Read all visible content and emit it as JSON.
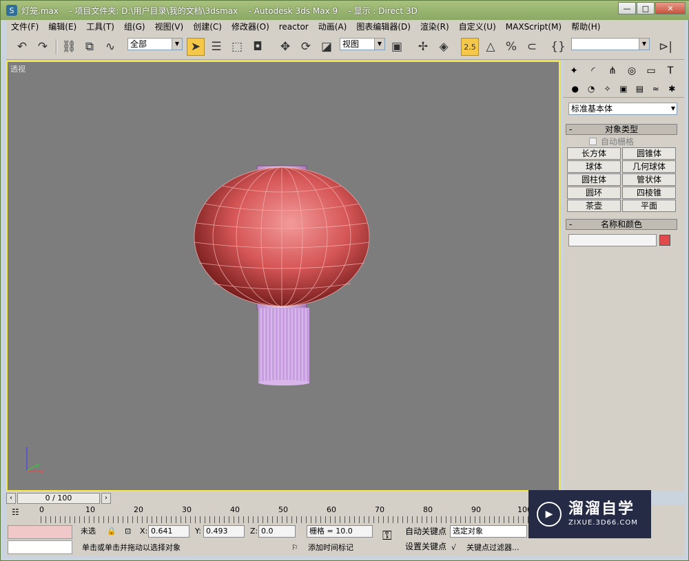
{
  "window": {
    "title": "灯笼.max    - 项目文件夹: D:\\用户目录\\我的文档\\3dsmax    - Autodesk 3ds Max 9    - 显示 : Direct 3D",
    "app_icon": "3ds-max-icon",
    "minimize": "—",
    "maximize": "□",
    "close": "✕"
  },
  "menu": [
    "文件(F)",
    "编辑(E)",
    "工具(T)",
    "组(G)",
    "视图(V)",
    "创建(C)",
    "修改器(O)",
    "reactor",
    "动画(A)",
    "图表编辑器(D)",
    "渲染(R)",
    "自定义(U)",
    "MAXScript(M)",
    "帮助(H)"
  ],
  "toolbar": {
    "selection_filter": "全部",
    "reference_coord": "视图",
    "snap_value": "2.5",
    "named_selection": ""
  },
  "viewport": {
    "label": "透视",
    "object": "lantern"
  },
  "command_panel": {
    "category": "标准基本体",
    "object_type_title": "对象类型",
    "auto_grid": "自动栅格",
    "object_buttons": [
      "长方体",
      "圆锥体",
      "球体",
      "几何球体",
      "圆柱体",
      "管状体",
      "圆环",
      "四棱锥",
      "茶壶",
      "平面"
    ],
    "name_color_title": "名称和颜色",
    "name_value": "",
    "swatch_color": "#e04a4a"
  },
  "timeline": {
    "frame_display": "0 / 100",
    "ticks": [
      "0",
      "10",
      "20",
      "30",
      "40",
      "50",
      "60",
      "70",
      "80",
      "90",
      "100"
    ]
  },
  "status": {
    "selection_status": "未选",
    "x_label": "X:",
    "x_value": "0.641",
    "y_label": "Y:",
    "y_value": "0.493",
    "z_label": "Z:",
    "z_value": "0.0",
    "grid": "栅格 = 10.0",
    "prompt": "单击或单击并拖动以选择对象",
    "add_time_tag": "添加时间标记",
    "auto_key": "自动关键点",
    "set_key": "设置关键点",
    "selected_object": "选定对象",
    "key_filters": "关键点过滤器..."
  },
  "watermark": {
    "title": "溜溜自学",
    "url": "ZIXUE.3D66.COM"
  }
}
